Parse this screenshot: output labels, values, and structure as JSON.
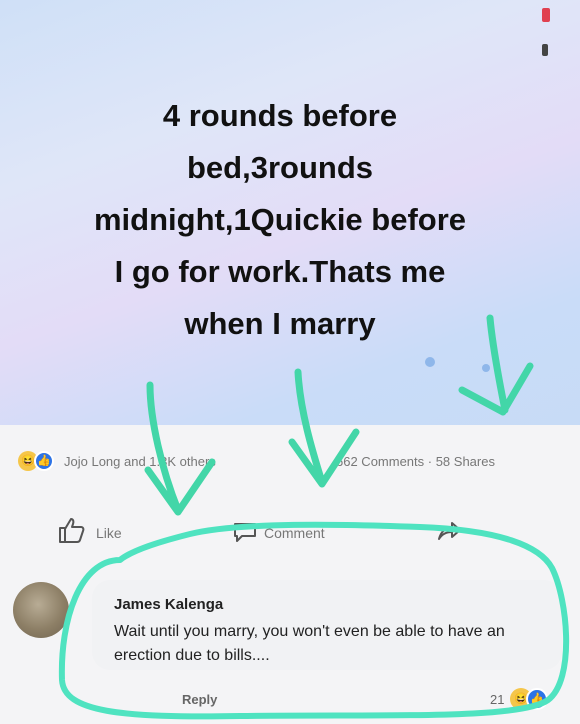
{
  "post": {
    "lines": [
      "4 rounds before",
      "bed,3rounds",
      "midnight,1Quickie before",
      "I go for work.Thats me",
      "when I marry"
    ]
  },
  "reactions": {
    "summary": "Jojo Long and 1.3K others",
    "comments_shares": "662 Comments · 58 Shares",
    "icons": [
      "haha-icon",
      "like-icon"
    ]
  },
  "actions": {
    "like": "Like",
    "comment": "Comment"
  },
  "comment": {
    "author": "James Kalenga",
    "text": "Wait until you marry, you won't even be able to have an erection due to bills....",
    "reply": "Reply",
    "reaction_count": "21"
  },
  "colors": {
    "annotation": "#4fe3c0",
    "arrow": "#43d6a8",
    "like_blue": "#2d73e6"
  }
}
